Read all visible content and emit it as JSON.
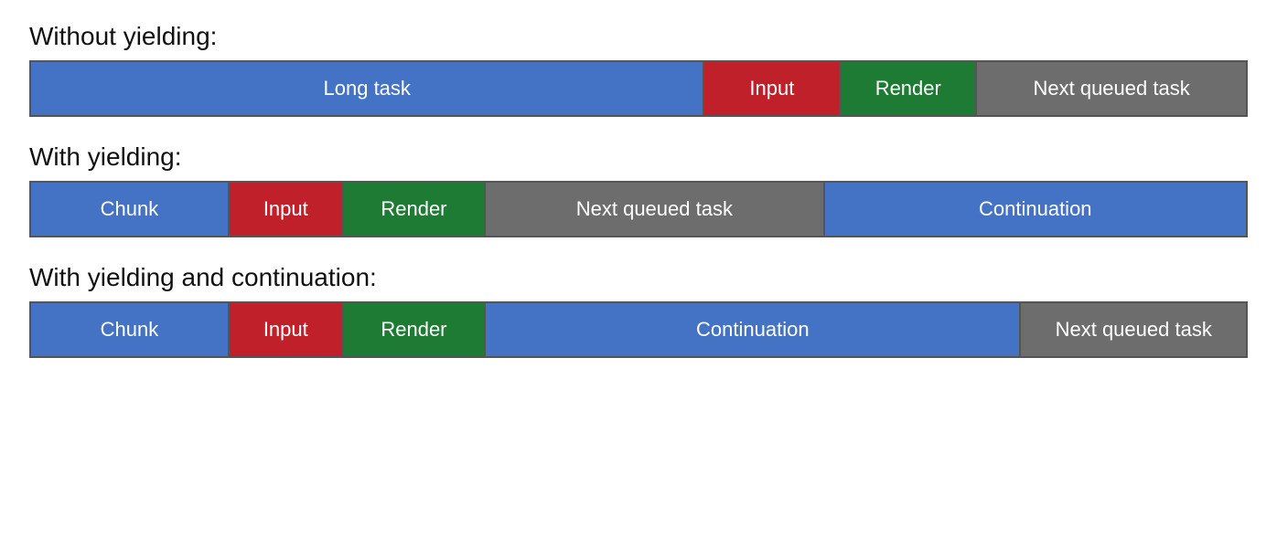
{
  "diagram1": {
    "title": "Without yielding:",
    "segments": [
      {
        "label": "Long task",
        "class": "seg-blue",
        "flex": 5
      },
      {
        "label": "Input",
        "class": "seg-red",
        "flex": 1
      },
      {
        "label": "Render",
        "class": "seg-green",
        "flex": 1
      },
      {
        "label": "Next queued task",
        "class": "seg-gray",
        "flex": 2
      }
    ]
  },
  "diagram2": {
    "title": "With yielding:",
    "segments": [
      {
        "label": "Chunk",
        "class": "seg-blue",
        "flex": 1.4
      },
      {
        "label": "Input",
        "class": "seg-red",
        "flex": 0.8
      },
      {
        "label": "Render",
        "class": "seg-green",
        "flex": 1
      },
      {
        "label": "Next queued task",
        "class": "seg-gray",
        "flex": 2.4
      },
      {
        "label": "Continuation",
        "class": "seg-blue",
        "flex": 3
      }
    ]
  },
  "diagram3": {
    "title": "With yielding and continuation:",
    "segments": [
      {
        "label": "Chunk",
        "class": "seg-blue",
        "flex": 1.4
      },
      {
        "label": "Input",
        "class": "seg-red",
        "flex": 0.8
      },
      {
        "label": "Render",
        "class": "seg-green",
        "flex": 1
      },
      {
        "label": "Continuation",
        "class": "seg-blue",
        "flex": 3.8
      },
      {
        "label": "Next queued task",
        "class": "seg-gray",
        "flex": 1.6
      }
    ]
  }
}
